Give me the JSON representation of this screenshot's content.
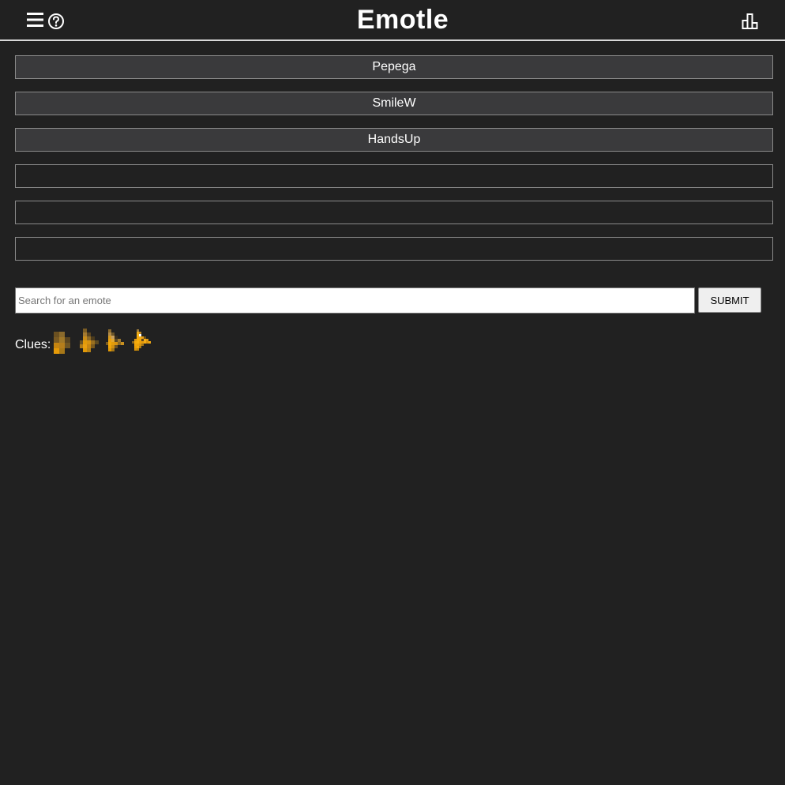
{
  "header": {
    "title": "Emotle",
    "menu_icon": "hamburger-menu-icon",
    "help_icon": "question-circle-icon",
    "stats_icon": "bar-chart-icon"
  },
  "guesses": [
    {
      "label": "Pepega"
    },
    {
      "label": "SmileW"
    },
    {
      "label": "HandsUp"
    },
    {
      "label": ""
    },
    {
      "label": ""
    },
    {
      "label": ""
    }
  ],
  "search": {
    "placeholder": "Search for an emote",
    "value": "",
    "submit_label": "SUBMIT"
  },
  "clues": {
    "label": "Clues:",
    "images": [
      "pixelated-emote-clue-1",
      "pixelated-emote-clue-2",
      "pixelated-emote-clue-3",
      "pixelated-emote-clue-4"
    ]
  },
  "colors": {
    "background": "#212121",
    "filled_row": "#3a3a3c",
    "row_border": "#8a8a8a",
    "text": "#ffffff"
  }
}
